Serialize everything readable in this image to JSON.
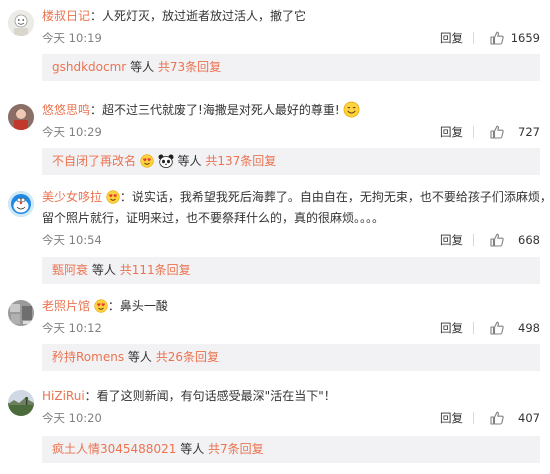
{
  "comments": [
    {
      "username": "楼叔日记",
      "separator": "：",
      "text": "人死灯灭，放过逝者放过活人，撤了它",
      "time": "今天 10:19",
      "reply_label": "回复",
      "likes": "1659",
      "sub_user": "gshdkdocmr",
      "others": "等人",
      "more": "共73条回复"
    },
    {
      "username": "悠悠思鸣",
      "separator": "：",
      "text": "超不过三代就废了!海撒是对死人最好的尊重!",
      "time": "今天 10:29",
      "reply_label": "回复",
      "likes": "727",
      "sub_user": "不自闭了再改名",
      "others": "等人",
      "more": "共137条回复"
    },
    {
      "username": "美少女哆拉",
      "separator": "：",
      "text": "说实话，我希望我死后海葬了。自由自在，无拘无束，也不要给孩子们添麻烦，",
      "text2": "留个照片就行，证明来过，也不要祭拜什么的，真的很麻烦。。。。",
      "time": "今天 10:54",
      "reply_label": "回复",
      "likes": "668",
      "sub_user": "甄阿衰",
      "others": "等人",
      "more": "共111条回复"
    },
    {
      "username": "老照片馆",
      "separator": "：",
      "text": "鼻头一酸",
      "time": "今天 10:12",
      "reply_label": "回复",
      "likes": "498",
      "sub_user": "矜持Romens",
      "others": "等人",
      "more": "共26条回复"
    },
    {
      "username": "HiZiRui",
      "separator": "：",
      "text": "看了这则新闻，有句话感受最深\"活在当下\"！",
      "time": "今天 10:20",
      "reply_label": "回复",
      "likes": "407",
      "sub_user": "疯土人情3045488021",
      "others": "等人",
      "more": "共7条回复"
    }
  ],
  "icons": {
    "like": "thumbs-up-icon",
    "emoji_smile": "smile-emoji-icon",
    "emoji_love": "heart-eyes-emoji-icon",
    "panda": "panda-emoji-icon"
  },
  "colors": {
    "username": "#eb7350",
    "reply_bg": "#f2f2f5",
    "meta": "#808080"
  }
}
